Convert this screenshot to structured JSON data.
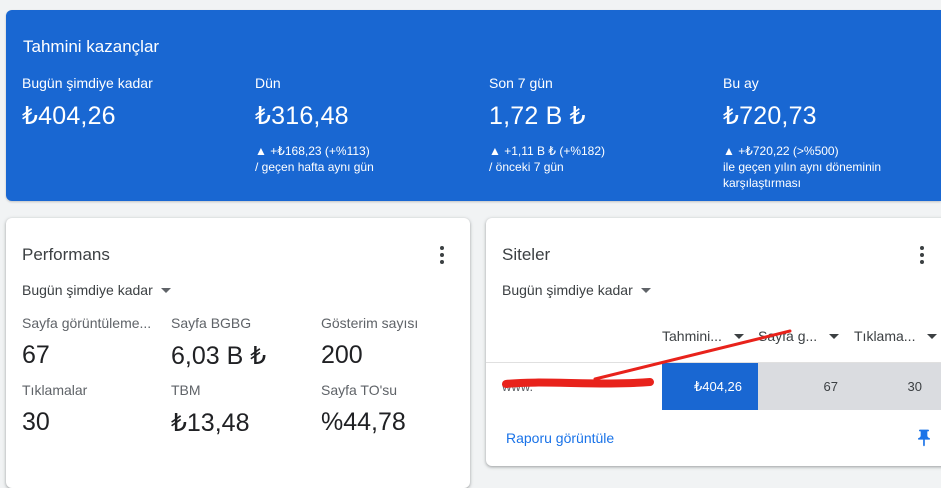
{
  "earnings": {
    "title": "Tahmini kazançlar",
    "columns": [
      {
        "label": "Bugün şimdiye kadar",
        "value": "₺404,26",
        "delta": "",
        "note": ""
      },
      {
        "label": "Dün",
        "value": "₺316,48",
        "delta": "▲ +₺168,23 (+%113)",
        "note": "/ geçen hafta aynı gün"
      },
      {
        "label": "Son 7 gün",
        "value": "1,72 B ₺",
        "delta": "▲ +1,11 B ₺ (+%182)",
        "note": "/ önceki 7 gün"
      },
      {
        "label": "Bu ay",
        "value": "₺720,73",
        "delta": "▲ +₺720,22 (>%500)",
        "note": "ile geçen yılın aynı döneminin karşılaştırması"
      }
    ]
  },
  "performance": {
    "title": "Performans",
    "period": "Bugün şimdiye kadar",
    "metrics": [
      {
        "label": "Sayfa görüntüleme...",
        "value": "67"
      },
      {
        "label": "Sayfa BGBG",
        "value": "6,03 B ₺"
      },
      {
        "label": "Gösterim sayısı",
        "value": "200"
      },
      {
        "label": "Tıklamalar",
        "value": "30"
      },
      {
        "label": "TBM",
        "value": "₺13,48"
      },
      {
        "label": "Sayfa TO'su",
        "value": "%44,78"
      }
    ]
  },
  "sites": {
    "title": "Siteler",
    "period": "Bugün şimdiye kadar",
    "columns": [
      "Tahmini...",
      "Sayfa g...",
      "Tıklama..."
    ],
    "row": {
      "site": "www.",
      "earnings": "₺404,26",
      "pageviews": "67",
      "clicks": "30"
    },
    "report_link": "Raporu görüntüle"
  },
  "colors": {
    "accent": "#1967d2",
    "link": "#1a73e8",
    "annotation": "#e8221b"
  },
  "icons": [
    "kebab-icon",
    "caret-down-icon",
    "pin-icon"
  ]
}
